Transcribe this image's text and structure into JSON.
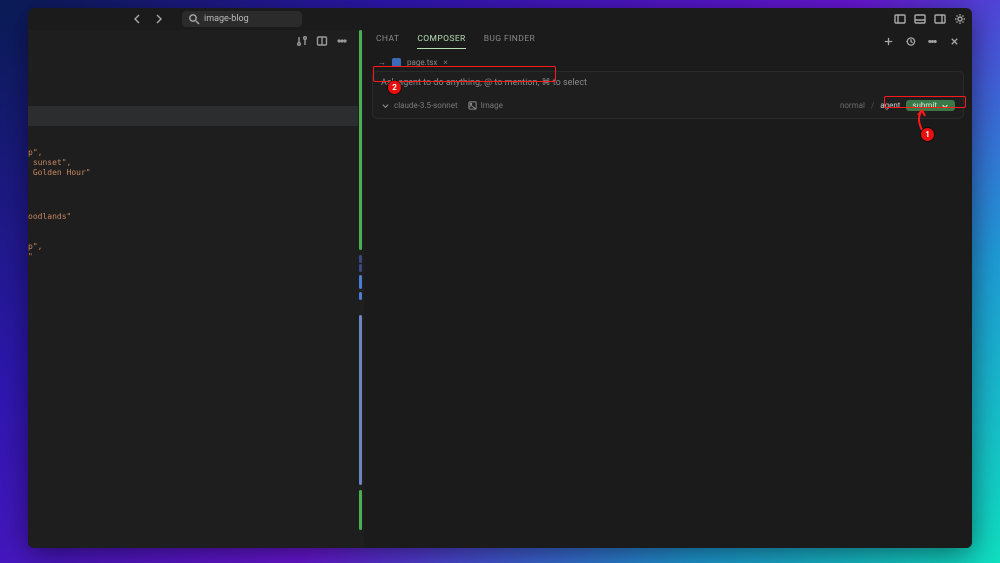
{
  "titlebar": {
    "search_prefix_icon": "search",
    "search_text": "image-blog"
  },
  "editor_toolbar": {
    "icon1": "retry",
    "icon2": "split",
    "icon3": "more"
  },
  "code": {
    "lines": [
      "p\",",
      " sunset\",",
      " Golden Hour\"",
      "",
      "oodlands\"",
      "",
      "p\",",
      "\""
    ]
  },
  "tabs": {
    "chat": "CHAT",
    "composer": "COMPOSER",
    "bug_finder": "BUG FINDER",
    "right_icons": [
      "plus",
      "history",
      "more",
      "close"
    ]
  },
  "crumb": {
    "arrow": "→",
    "file": "page.tsx",
    "close": "×"
  },
  "composer": {
    "placeholder": "Ask agent to do anything, @ to mention, ⌘ to select",
    "model": "claude-3.5-sonnet",
    "attach": "Image",
    "mode_normal": "normal",
    "mode_sep": "/",
    "mode_agent": "agent",
    "submit": "submit"
  },
  "annotations": {
    "b1": "1",
    "b2": "2"
  }
}
